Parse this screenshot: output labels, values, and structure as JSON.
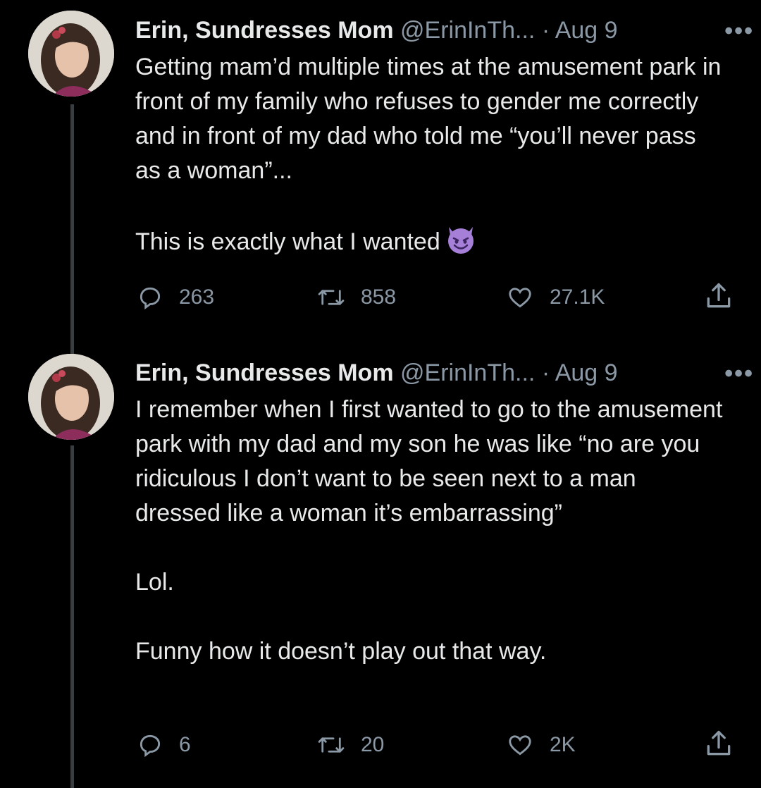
{
  "tweets": [
    {
      "name": "Erin, Sundresses Mom",
      "handle": "@ErinInTh...",
      "dot": "·",
      "date": "Aug 9",
      "more": "•••",
      "text_p1": "Getting mam’d multiple times at the amusement park in front of my family who refuses to gender me correctly and in front of my dad who told me “you’ll never pass as a woman”...",
      "text_p2": "This is exactly what I wanted",
      "emoji": "smiling-face-with-horns",
      "replies": "263",
      "retweets": "858",
      "likes": "27.1K"
    },
    {
      "name": "Erin, Sundresses Mom",
      "handle": "@ErinInTh...",
      "dot": "·",
      "date": "Aug 9",
      "more": "•••",
      "text_p1": "I remember when I first wanted to go to the amusement park with my dad and my son he was like “no are you ridiculous I don’t want to be seen next to a man dressed like a woman it’s embarrassing”",
      "text_p2": "Lol.",
      "text_p3": "Funny how it doesn’t play out that way.",
      "replies": "6",
      "retweets": "20",
      "likes": "2K"
    }
  ],
  "colors": {
    "background": "#000000",
    "text": "#e7e9ea",
    "secondary": "#8b98a5",
    "thread_line": "#3a3d40",
    "emoji": "#a57fd8"
  }
}
